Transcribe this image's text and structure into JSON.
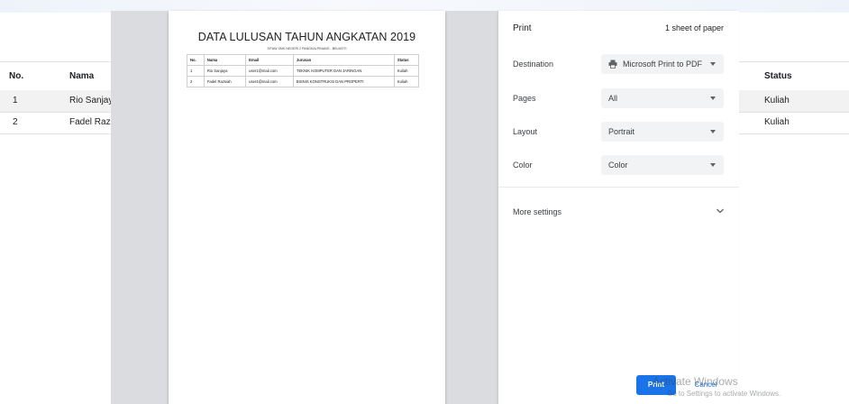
{
  "background_table": {
    "headers": [
      "No.",
      "Nama",
      "Status"
    ],
    "rows": [
      {
        "no": "1",
        "nama": "Rio Sanjaya",
        "status": "Kuliah"
      },
      {
        "no": "2",
        "nama": "Fadel Razs",
        "status": "Kuliah"
      }
    ]
  },
  "preview": {
    "title": "DATA LULUSAN TAHUN ANGKATAN 2019",
    "subtitle": "SITAW SMK NEGERI 2 PANGKALPINANG - BELMOTI",
    "headers": [
      "No.",
      "Nama",
      "Email",
      "Jurusan",
      "Status"
    ],
    "rows": [
      [
        "1",
        "Rio Sanjaya",
        "user1@mail.com",
        "TEKNIK KOMPUTER DAN JARINGAN",
        "Kuliah"
      ],
      [
        "2",
        "Fadel Razsiah",
        "user4@mail.com",
        "BISNIS KONSTRUKSI DAN PROPERTI",
        "Kuliah"
      ]
    ]
  },
  "print_panel": {
    "title": "Print",
    "sheets": "1 sheet of paper",
    "destination_label": "Destination",
    "destination_value": "Microsoft Print to PDF",
    "pages_label": "Pages",
    "pages_value": "All",
    "layout_label": "Layout",
    "layout_value": "Portrait",
    "color_label": "Color",
    "color_value": "Color",
    "more_settings": "More settings",
    "print_button": "Print",
    "cancel_button": "Cancel"
  },
  "watermark": {
    "title": "Activate Windows",
    "subtitle": "Go to Settings to activate Windows."
  },
  "colors": {
    "accent": "#1a73e8",
    "preview_bg": "#dadce0",
    "select_bg": "#f1f3f4"
  },
  "icons": [
    "printer-icon",
    "chevron-down-icon",
    "dropdown-caret-icon"
  ]
}
